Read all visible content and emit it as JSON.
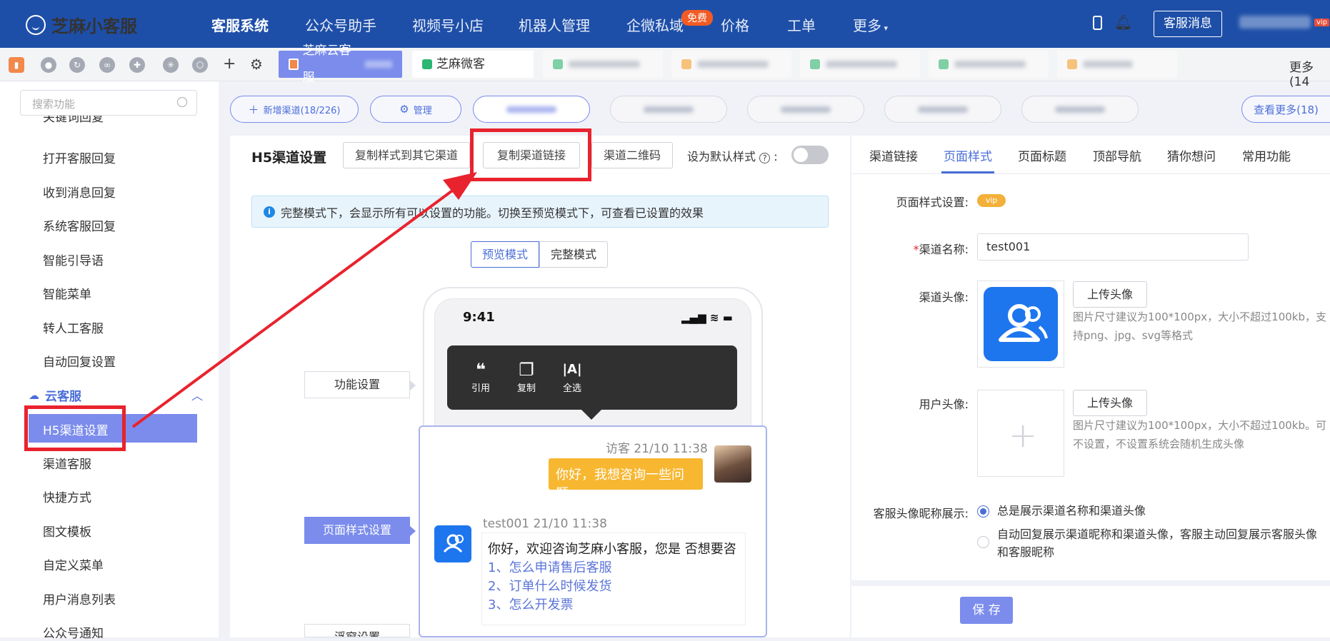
{
  "topnav": {
    "logo": "芝麻小客服",
    "items": [
      "客服系统",
      "公众号助手",
      "视频号小店",
      "机器人管理",
      "企微私域",
      "价格",
      "工单",
      "更多"
    ],
    "free_badge": "免费",
    "cs_message": "客服消息",
    "vip": "vip"
  },
  "tabbar": {
    "active_tab": "芝麻云客服",
    "tab2": "芝麻微客",
    "more": "更多(14"
  },
  "sidebar": {
    "search_placeholder": "搜索功能",
    "partial_top": "关键词回复",
    "items_before": [
      "打开客服回复",
      "收到消息回复",
      "系统客服回复",
      "智能引导语",
      "智能菜单",
      "转人工客服",
      "自动回复设置"
    ],
    "group": "云客服",
    "active": "H5渠道设置",
    "items_after": [
      "渠道客服",
      "快捷方式",
      "图文模板",
      "自定义菜单",
      "用户消息列表",
      "公众号通知"
    ]
  },
  "channels": {
    "add": "新增渠道(18/226)",
    "manage": "管理",
    "view_more": "查看更多(18)"
  },
  "panel": {
    "title": "H5渠道设置",
    "copy_style": "复制样式到其它渠道",
    "copy_link": "复制渠道链接",
    "qrcode": "渠道二维码",
    "default_label": "设为默认样式",
    "info": "完整模式下，会显示所有可以设置的功能。切换至预览模式下，可查看已设置的效果",
    "mode_preview": "预览模式",
    "mode_full": "完整模式",
    "flags": [
      "功能设置",
      "页面样式设置",
      "浮窗设置"
    ]
  },
  "phone": {
    "time": "9:41",
    "ctx_items": [
      {
        "glyph": "❝",
        "label": "引用"
      },
      {
        "glyph": "❐",
        "label": "复制"
      },
      {
        "glyph": "|A|",
        "label": "全选"
      }
    ],
    "visitor_meta": "访客 21/10 11:38",
    "visitor_msg": "你好，我想咨询一些问题",
    "bot_meta": "test001 21/10 11:38",
    "bot_greeting": "你好，欢迎咨询芝麻小客服，您是 否想要咨",
    "bot_questions": [
      "1、怎么申请售后客服",
      "2、订单什么时候发货",
      "3、怎么开发票"
    ]
  },
  "right": {
    "tabs": [
      "渠道链接",
      "页面样式",
      "页面标题",
      "顶部导航",
      "猜你想问",
      "常用功能"
    ],
    "style_label": "页面样式设置:",
    "vip": "vip",
    "name_label": "渠道名称:",
    "name_value": "test001",
    "avatar_label": "渠道头像:",
    "upload": "上传头像",
    "avatar_hint": "图片尺寸建议为100*100px，大小不超过100kb，支持png、jpg、svg等格式",
    "user_avatar_label": "用户头像:",
    "user_avatar_hint": "图片尺寸建议为100*100px，大小不超过100kb。可不设置，不设置系统会随机生成头像",
    "nick_label": "客服头像昵称展示:",
    "opt1": "总是展示渠道名称和渠道头像",
    "opt2": "自动回复展示渠道昵称和渠道头像，客服主动回复展示客服头像和客服昵称",
    "save": "保 存"
  },
  "colors": {
    "nav": "#1e4fa8",
    "accent": "#7b8cec",
    "annotation": "#e8232e"
  }
}
